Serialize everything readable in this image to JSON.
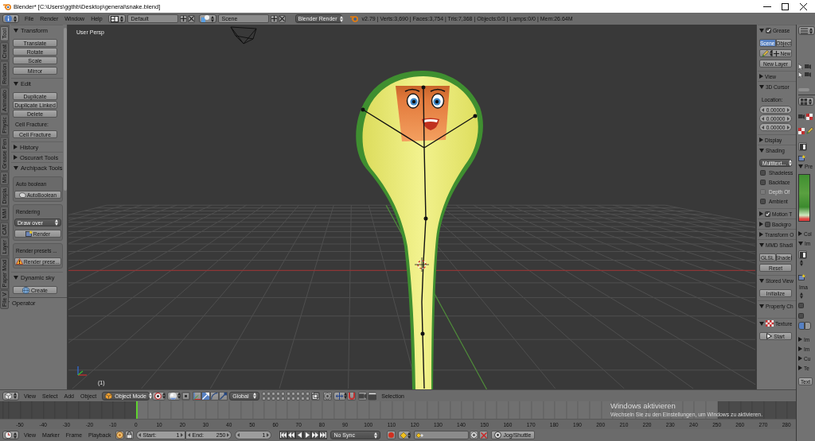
{
  "window": {
    "title": "Blender* [C:\\Users\\ggthb\\Desktop\\general\\snake.blend]"
  },
  "info_header": {
    "menus": [
      "File",
      "Render",
      "Window",
      "Help"
    ],
    "layout": "Default",
    "scene": "Scene",
    "engine": "Blender Render",
    "stats": "v2.79 | Verts:3,690 | Faces:3,754 | Tris:7,368 | Objects:0/3 | Lamps:0/0 | Mem:26.64M"
  },
  "tool_tabs": [
    {
      "label": "Tool",
      "selected": true
    },
    {
      "label": "Creat",
      "selected": false
    },
    {
      "label": "Relation",
      "selected": false
    },
    {
      "label": "Animatio",
      "selected": false
    },
    {
      "label": "Physic",
      "selected": false
    },
    {
      "label": "Grease Pen",
      "selected": false
    },
    {
      "label": "Mis",
      "selected": false
    },
    {
      "label": "Displa",
      "selected": false
    },
    {
      "label": "MM",
      "selected": false
    },
    {
      "label": "CAT",
      "selected": false
    },
    {
      "label": "Layer",
      "selected": false
    },
    {
      "label": "Paper Mod",
      "selected": false
    },
    {
      "label": "File V",
      "selected": false
    }
  ],
  "tool_shelf": {
    "sections": [
      {
        "title": "Transform",
        "expanded": true,
        "items": [
          {
            "kind": "column",
            "buttons": [
              "Translate",
              "Rotate",
              "Scale"
            ]
          },
          {
            "kind": "button",
            "label": "Mirror"
          }
        ]
      },
      {
        "title": "Edit",
        "expanded": true,
        "items": [
          {
            "kind": "column",
            "buttons": [
              "Duplicate",
              "Duplicate Linked",
              "Delete"
            ]
          },
          {
            "kind": "label",
            "text": "Cell Fracture:"
          },
          {
            "kind": "button",
            "label": "Cell Fracture"
          }
        ]
      },
      {
        "title": "History",
        "expanded": false
      },
      {
        "title": "Oscurart Tools",
        "expanded": false
      },
      {
        "title": "Archipack Tools",
        "expanded": true,
        "items": [
          {
            "kind": "box",
            "items": [
              {
                "kind": "label",
                "text": "Auto boolean"
              },
              {
                "kind": "iconbutton",
                "label": "AutoBoolean"
              }
            ]
          },
          {
            "kind": "box",
            "items": [
              {
                "kind": "label",
                "text": "Rendering"
              },
              {
                "kind": "dropdown",
                "value": "Draw over"
              },
              {
                "kind": "iconbutton",
                "label": "Render"
              }
            ]
          },
          {
            "kind": "box",
            "items": [
              {
                "kind": "label",
                "text": "Render presets ..."
              },
              {
                "kind": "iconbutton",
                "label": "Render prese..."
              }
            ]
          }
        ]
      },
      {
        "title": "Dynamic sky",
        "expanded": true,
        "items": [
          {
            "kind": "iconbutton",
            "label": "Create"
          }
        ]
      }
    ],
    "footer": {
      "title": "Operator",
      "expanded": true
    }
  },
  "viewport": {
    "view_name": "User Persp",
    "frame": "(1)"
  },
  "n_panel": {
    "sections": [
      {
        "title": "Grease",
        "expanded": true,
        "checked": true,
        "items": [
          {
            "kind": "tabs",
            "options": [
              {
                "label": "Scene",
                "selected": true
              },
              {
                "label": "Object",
                "selected": false
              }
            ]
          },
          {
            "kind": "row",
            "items": [
              {
                "kind": "icondropdown"
              },
              {
                "kind": "iconbutton",
                "label": "New"
              }
            ]
          },
          {
            "kind": "button",
            "label": "New Layer"
          }
        ]
      },
      {
        "title": "View",
        "expanded": false
      },
      {
        "title": "3D Cursor",
        "expanded": true,
        "items": [
          {
            "kind": "label",
            "text": "Location:"
          },
          {
            "kind": "fields",
            "values": [
              "0.00000",
              "0.00000",
              "0.00000"
            ]
          }
        ]
      },
      {
        "title": "Display",
        "expanded": false
      },
      {
        "title": "Shading",
        "expanded": true,
        "items": [
          {
            "kind": "dropdown",
            "value": "Multitext..."
          },
          {
            "kind": "checkbox",
            "label": "Shadeless",
            "checked": false,
            "disabled": false
          },
          {
            "kind": "checkbox",
            "label": "Backface",
            "checked": false,
            "disabled": false
          },
          {
            "kind": "checkbox",
            "label": "Depth Of",
            "checked": false,
            "disabled": true
          },
          {
            "kind": "checkbox",
            "label": "Ambient",
            "checked": false,
            "disabled": false
          }
        ]
      },
      {
        "title": "Motion T",
        "expanded": false,
        "checked": true
      },
      {
        "title": "Backgro",
        "expanded": false,
        "checked": false
      },
      {
        "title": "Transform O",
        "expanded": false
      },
      {
        "title": "MMD Shadi",
        "expanded": true,
        "items": [
          {
            "kind": "row",
            "items": [
              {
                "kind": "button",
                "label": "GLSL"
              },
              {
                "kind": "button",
                "label": "Shadel"
              }
            ]
          },
          {
            "kind": "button",
            "label": "Reset"
          }
        ]
      },
      {
        "title": "Stored View",
        "expanded": true,
        "items": [
          {
            "kind": "button",
            "label": "Initialize"
          }
        ]
      },
      {
        "title": "Property Ch",
        "expanded": true
      },
      {
        "title": "Texture",
        "expanded": true,
        "icon": true,
        "items": [
          {
            "kind": "iconbutton",
            "label": "Start"
          }
        ]
      }
    ]
  },
  "view_header": {
    "menus": [
      "View",
      "Select",
      "Add",
      "Object"
    ],
    "mode": "Object Mode",
    "manipulators": [
      {
        "selected": false
      },
      {
        "selected": true
      },
      {
        "selected": false
      },
      {
        "selected": false
      }
    ],
    "orientation": "Global",
    "selection": "Selection"
  },
  "properties_column": {
    "panels": [
      {
        "kind": "preview",
        "title": "Pre",
        "expanded": true
      },
      {
        "kind": "plain",
        "title": "Col",
        "expanded": false
      },
      {
        "kind": "image",
        "title": "Im",
        "expanded": true,
        "label": "Ima",
        "checks": [
          {
            "checked": false
          },
          {
            "checked": false
          }
        ],
        "switch": [
          {
            "selected": true
          },
          {
            "selected": false
          }
        ]
      },
      {
        "kind": "plain",
        "title": "Im",
        "expanded": false
      },
      {
        "kind": "plain",
        "title": "Im",
        "expanded": false
      },
      {
        "kind": "plain",
        "title": "Cu",
        "expanded": false
      },
      {
        "kind": "plain",
        "title": "Te",
        "expanded": false
      }
    ],
    "button": "Text"
  },
  "timeline": {
    "ruler": [
      "-50",
      "-40",
      "-30",
      "-20",
      "-10",
      "0",
      "10",
      "20",
      "30",
      "40",
      "50",
      "60",
      "70",
      "80",
      "90",
      "100",
      "110",
      "120",
      "130",
      "140",
      "150",
      "160",
      "170",
      "180",
      "190",
      "200",
      "210",
      "220",
      "230",
      "240",
      "250",
      "260",
      "270",
      "280"
    ]
  },
  "timeline_header": {
    "menus": [
      "View",
      "Marker",
      "Frame",
      "Playback"
    ],
    "start": {
      "label": "Start:",
      "value": "1"
    },
    "end": {
      "label": "End:",
      "value": "250"
    },
    "current": "1",
    "sync": "No Sync",
    "jog": "Jog/Shuttle"
  },
  "activation_notice": {
    "title": "Windows aktivieren",
    "text": "Wechseln Sie zu den Einstellungen, um Windows zu aktivieren."
  }
}
